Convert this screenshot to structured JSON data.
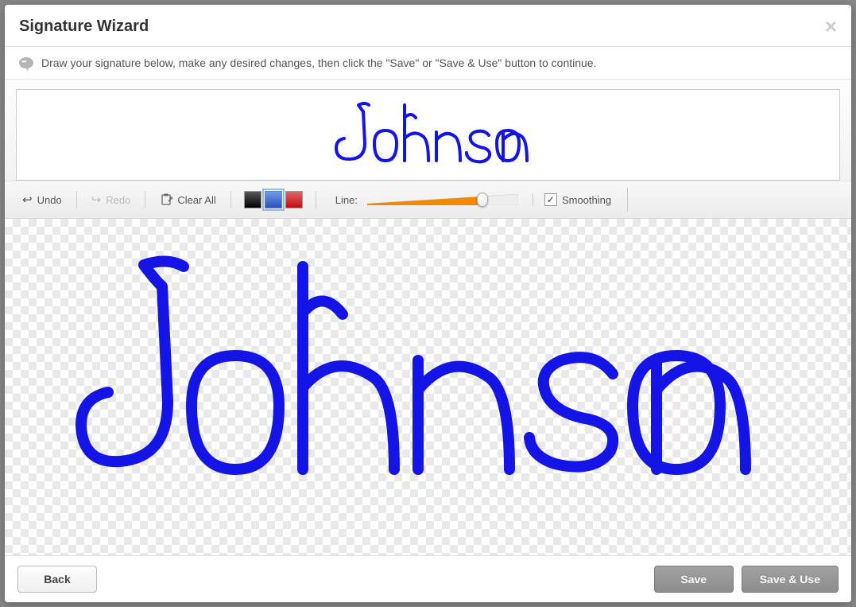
{
  "modal": {
    "title": "Signature Wizard",
    "instruction": "Draw your signature below, make any desired changes, then click the \"Save\" or \"Save & Use\" button to continue."
  },
  "signature_text": "Johnson",
  "toolbar": {
    "undo_label": "Undo",
    "redo_label": "Redo",
    "clear_label": "Clear All",
    "line_label": "Line:",
    "smoothing_label": "Smoothing",
    "smoothing_checked": true,
    "colors": {
      "black": "#000000",
      "blue": "#2b5fd9",
      "red": "#d31212"
    },
    "selected_color": "blue",
    "slider_fill_color": "#f08a00",
    "slider_position_pct": 73
  },
  "footer": {
    "back_label": "Back",
    "save_label": "Save",
    "save_use_label": "Save & Use"
  }
}
